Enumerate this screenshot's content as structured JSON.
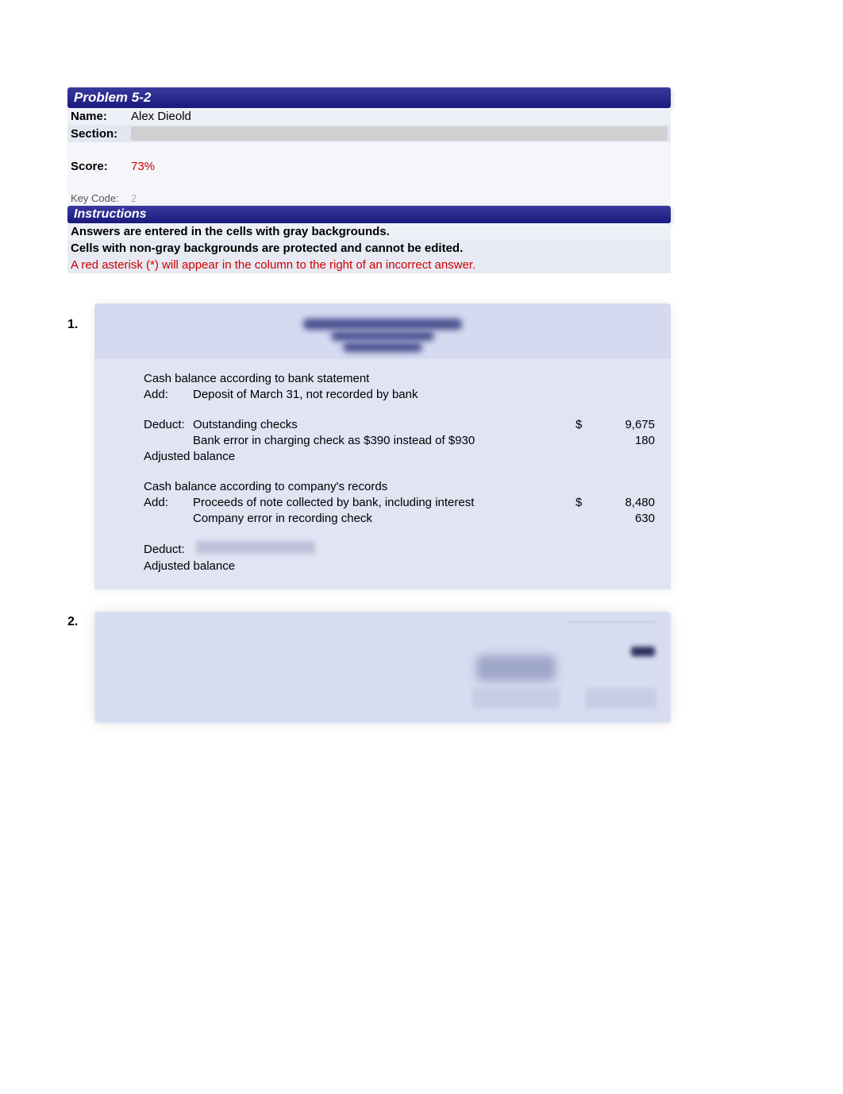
{
  "header": {
    "title": "Problem 5-2"
  },
  "info": {
    "name_label": "Name:",
    "name_value": "Alex Dieold",
    "section_label": "Section:",
    "section_value": "",
    "score_label": "Score:",
    "score_value": "73%",
    "keycode_label": "Key Code:",
    "keycode_value": "2"
  },
  "instructions": {
    "title": "Instructions",
    "line1": "Answers are entered in the cells with gray backgrounds.",
    "line2": "Cells with non-gray backgrounds are protected and cannot be edited.",
    "line3": "A red asterisk (*) will appear in the column to the right of an incorrect answer."
  },
  "problem1": {
    "number": "1.",
    "rows": {
      "bank_balance": "Cash balance according to bank statement",
      "add1_label": "Add:",
      "add1_desc": "Deposit of March 31, not recorded by bank",
      "deduct1_label": "Deduct:",
      "deduct1_desc": "Outstanding checks",
      "deduct1_sym": "$",
      "deduct1_amt": "9,675",
      "deduct2_desc": "Bank error in charging check as $390 instead of $930",
      "deduct2_amt": "180",
      "adj1": "Adjusted balance",
      "company_balance": "Cash balance according to company's records",
      "add2_label": "Add:",
      "add2_desc": "Proceeds of note collected by bank, including interest",
      "add2_sym": "$",
      "add2_amt": "8,480",
      "add3_desc": "Company error in recording check",
      "add3_amt": "630",
      "deduct3_label": "Deduct:",
      "adj2": "Adjusted balance"
    }
  },
  "problem2": {
    "number": "2."
  }
}
